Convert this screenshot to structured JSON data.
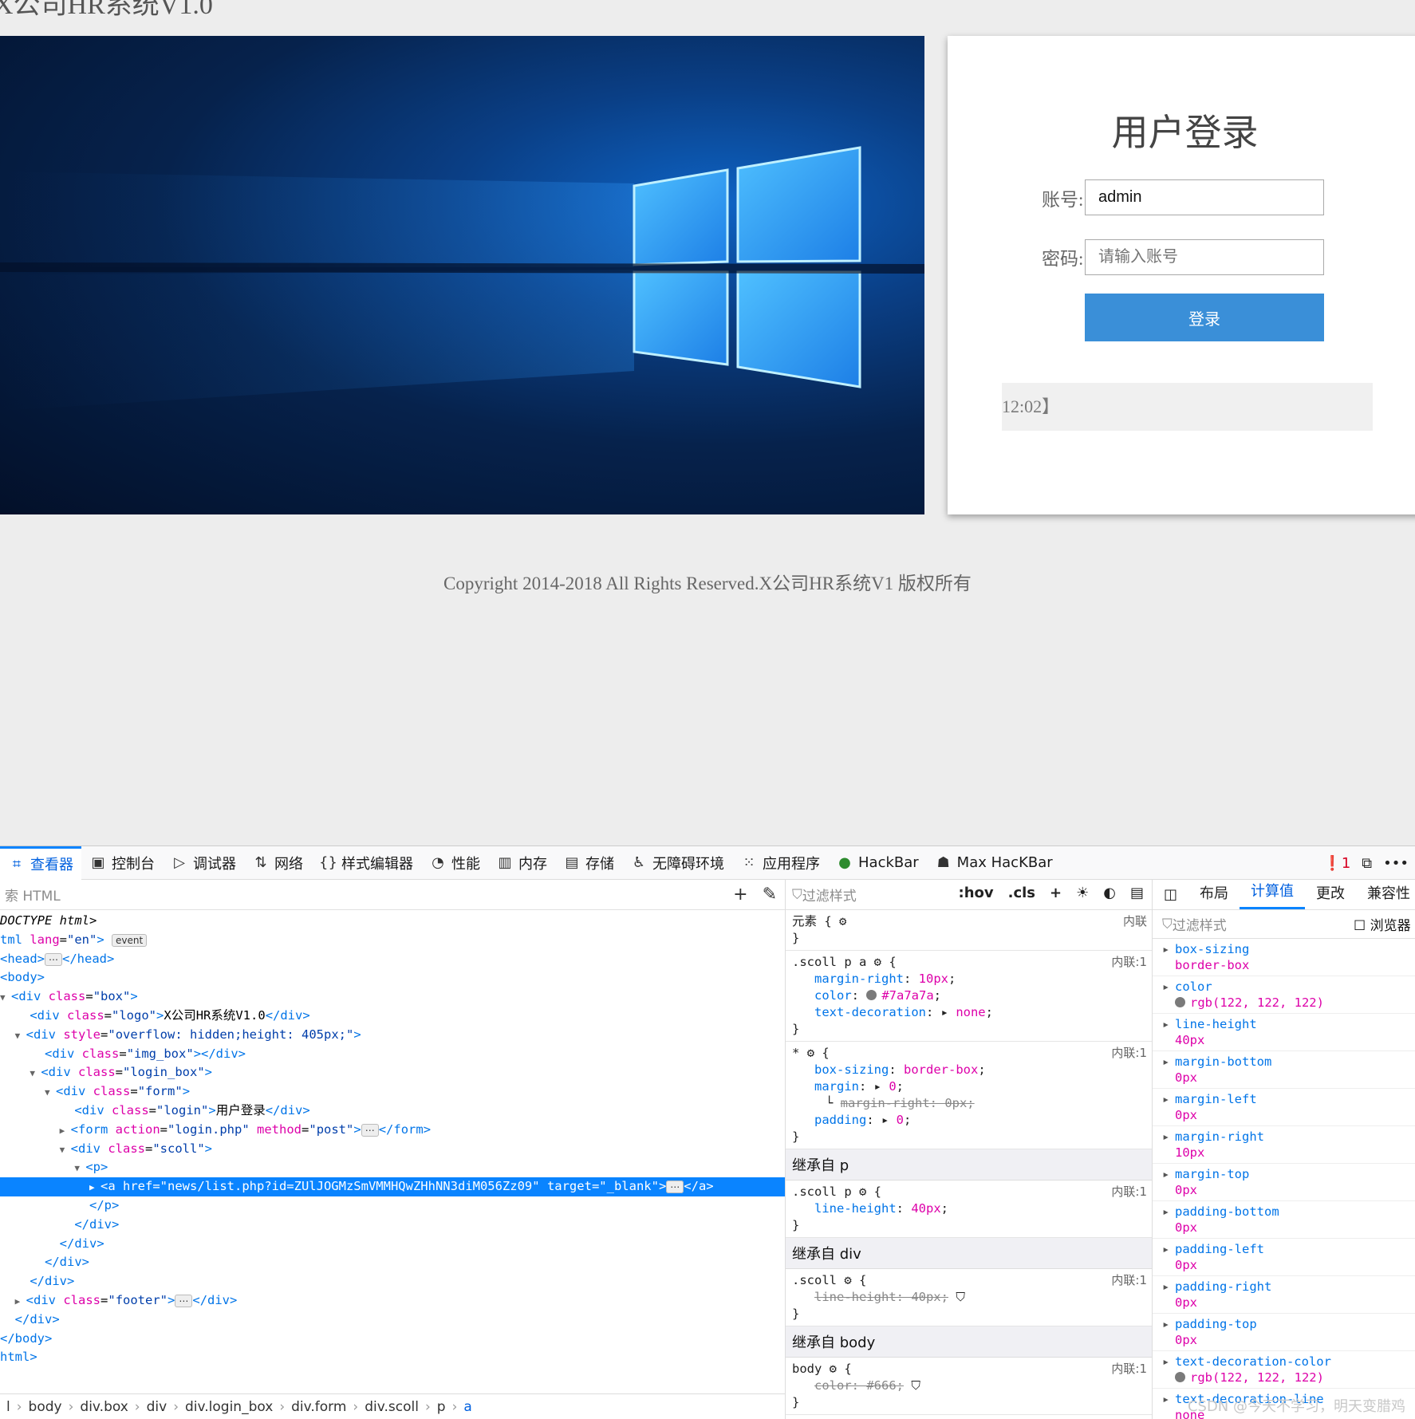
{
  "page": {
    "logo_text": "X公司HR系统V1.0",
    "login_title": "用户登录",
    "username_label": "账号:",
    "username_value": "admin",
    "password_label": "密码:",
    "password_placeholder": "请输入账号",
    "login_button": "登录",
    "scroll_text": "12:02】",
    "footer": "Copyright 2014-2018 All Rights Reserved.X公司HR系统V1 版权所有"
  },
  "devtools": {
    "tabs": [
      {
        "icon": "inspector-icon",
        "glyph": "⌗",
        "label": "查看器"
      },
      {
        "icon": "console-icon",
        "glyph": "▣",
        "label": "控制台"
      },
      {
        "icon": "debugger-icon",
        "glyph": "▷",
        "label": "调试器"
      },
      {
        "icon": "network-icon",
        "glyph": "⇅",
        "label": "网络"
      },
      {
        "icon": "style-editor-icon",
        "glyph": "{}",
        "label": "样式编辑器"
      },
      {
        "icon": "performance-icon",
        "glyph": "◔",
        "label": "性能"
      },
      {
        "icon": "memory-icon",
        "glyph": "▥",
        "label": "内存"
      },
      {
        "icon": "storage-icon",
        "glyph": "▤",
        "label": "存储"
      },
      {
        "icon": "accessibility-icon",
        "glyph": "♿",
        "label": "无障碍环境"
      },
      {
        "icon": "application-icon",
        "glyph": "⁙",
        "label": "应用程序"
      },
      {
        "icon": "hackbar-icon",
        "glyph": "●",
        "label": "HackBar"
      },
      {
        "icon": "max-hackbar-icon",
        "glyph": "☗",
        "label": "Max HacKBar"
      }
    ],
    "error_count": "1",
    "search_placeholder": "索 HTML",
    "tree": {
      "l1": "DOCTYPE html>",
      "l2_tag": "tml",
      "l2_attr": "lang",
      "l2_val": "\"en\"",
      "l2_badge": "event",
      "l3": "<head>",
      "l3_end": "</head>",
      "l4": "<body>",
      "l5_class": "\"box\"",
      "l6_class": "\"logo\"",
      "l6_text": "X公司HR系统V1.0",
      "l7_style": "\"overflow: hidden;height: 405px;\"",
      "l8_class": "\"img_box\"",
      "l9_class": "\"login_box\"",
      "l10_class": "\"form\"",
      "l11_class": "\"login\"",
      "l11_text": "用户登录",
      "l12_action": "\"login.php\"",
      "l12_method": "\"post\"",
      "l13_class": "\"scoll\"",
      "l15_href": "\"news/list.php?id=ZUlJOGMzSmVMMHQwZHhNN3diM056Zz09\"",
      "l15_target": "\"_blank\"",
      "l22_class": "\"footer\"",
      "l24": "</body>",
      "l25": "html>"
    },
    "breadcrumb": [
      "l",
      "body",
      "div.box",
      "div",
      "div.login_box",
      "div.form",
      "div.scoll",
      "p",
      "a"
    ],
    "rules": {
      "filter_placeholder": "过滤样式",
      "hov": ":hov",
      "cls": ".cls",
      "element": "元素",
      "inline": "内联",
      "inline1": "内联:1",
      "r1_sel": ".scoll p a",
      "r1_p1n": "margin-right",
      "r1_p1v": "10px",
      "r1_p2n": "color",
      "r1_p2v": "#7a7a7a",
      "r1_p3n": "text-decoration",
      "r1_p3v": "none",
      "r2_sel": "*",
      "r2_p1n": "box-sizing",
      "r2_p1v": "border-box",
      "r2_p2n": "margin",
      "r2_p2v": "0",
      "r2_p3": "margin-right: 0px;",
      "r2_p4n": "padding",
      "r2_p4v": "0",
      "inh_p": "继承自 p",
      "r3_sel": ".scoll p",
      "r3_p1n": "line-height",
      "r3_p1v": "40px",
      "inh_div": "继承自 div",
      "r4_sel": ".scoll",
      "r4_p1": "line-height: 40px;",
      "inh_body": "继承自 body",
      "r5_sel": "body",
      "r5_p1": "color: #666;"
    },
    "computed": {
      "tabs": [
        "布局",
        "计算值",
        "更改",
        "兼容性"
      ],
      "filter_placeholder": "过滤样式",
      "browser_label": "浏览器",
      "items": [
        {
          "name": "box-sizing",
          "value": "border-box"
        },
        {
          "name": "color",
          "value": "rgb(122, 122, 122)"
        },
        {
          "name": "line-height",
          "value": "40px"
        },
        {
          "name": "margin-bottom",
          "value": "0px"
        },
        {
          "name": "margin-left",
          "value": "0px"
        },
        {
          "name": "margin-right",
          "value": "10px"
        },
        {
          "name": "margin-top",
          "value": "0px"
        },
        {
          "name": "padding-bottom",
          "value": "0px"
        },
        {
          "name": "padding-left",
          "value": "0px"
        },
        {
          "name": "padding-right",
          "value": "0px"
        },
        {
          "name": "padding-top",
          "value": "0px"
        },
        {
          "name": "text-decoration-color",
          "value": "rgb(122, 122, 122)"
        },
        {
          "name": "text-decoration-line",
          "value": "none"
        }
      ]
    },
    "watermark": "CSDN @今天不学习，明天变腊鸡"
  }
}
